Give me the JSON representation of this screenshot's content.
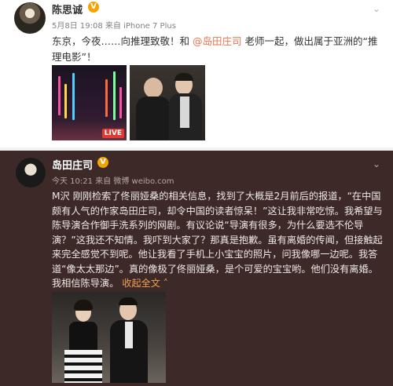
{
  "post1": {
    "author": "陈思诚",
    "meta": "5月8日 19:08 来自 iPhone 7 Plus",
    "text_before": "东京，今夜……向推理致敬！和 ",
    "mention": "@岛田庄司",
    "text_after": " 老师一起，做出属于亚洲的“推理电影”！",
    "live_badge": "LIVE"
  },
  "post2": {
    "author": "岛田庄司",
    "meta": "今天 10:21 来自 微博 weibo.com",
    "body": "M沢 刚刚检索了佟丽娅桑的相关信息，找到了大概是2月前后的报道，“在中国颇有人气的作家岛田庄司，却令中国的读者惊呆！”这让我非常吃惊。我希望与陈导演合作御手洗系列的网剧。有议论说“导演有很多，为什么要选不伦导演？”这我还不知情。我吓到大家了？那真是抱歉。虽有离婚的传闻，但接触起来完全感觉不到呢。他让我看了手机上小宝宝的照片，问我像哪一边呢。我答道“像太太那边”。真的像极了佟丽娅桑，是个可爱的宝宝哟。他们没有离婚。我相信陈导演。",
    "expand": "收起全文",
    "expand_icon": "chevron-up-icon"
  },
  "colors": {
    "dark_bg": "#3d2a28",
    "mention": "#eb7350",
    "verified": "#f4a300"
  }
}
